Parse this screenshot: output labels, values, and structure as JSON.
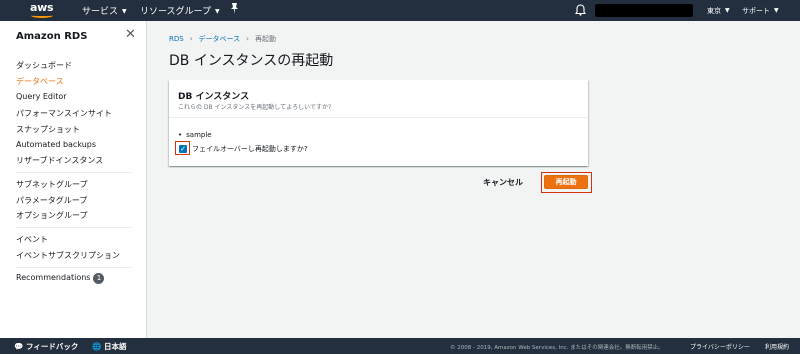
{
  "topnav": {
    "logo": "aws",
    "services": "サービス",
    "resource_groups": "リソースグループ",
    "pin_icon": "pin-icon",
    "bell_icon": "bell-icon",
    "region": "東京",
    "support": "サポート"
  },
  "sidebar": {
    "title": "Amazon RDS",
    "items": [
      "ダッシュボード",
      "データベース",
      "Query Editor",
      "パフォーマンスインサイト",
      "スナップショット",
      "Automated backups",
      "リザーブドインスタンス",
      "サブネットグループ",
      "パラメータグループ",
      "オプショングループ",
      "イベント",
      "イベントサブスクリプション",
      "Recommendations"
    ],
    "active_index": 1,
    "recommendations_count": "1"
  },
  "breadcrumb": {
    "items": [
      "RDS",
      "データベース"
    ],
    "current": "再起動"
  },
  "page_title": "DB インスタンスの再起動",
  "panel": {
    "title": "DB インスタンス",
    "subtitle": "これらの DB インスタンスを再起動してよろしいですか?",
    "instances": [
      "sample"
    ],
    "failover_label": "フェイルオーバーし再起動しますか?",
    "failover_checked": true
  },
  "actions": {
    "cancel": "キャンセル",
    "reboot": "再起動"
  },
  "footer": {
    "feedback": "フィードバック",
    "language": "日本語",
    "copyright": "© 2008 - 2019, Amazon Web Services, Inc. またはその関連会社。無断転用禁止。",
    "privacy": "プライバシーポリシー",
    "terms": "利用規約"
  },
  "colors": {
    "nav_bg": "#232f3e",
    "accent_orange": "#ec7211",
    "link_blue": "#0073bb",
    "highlight_red": "#d13212"
  }
}
